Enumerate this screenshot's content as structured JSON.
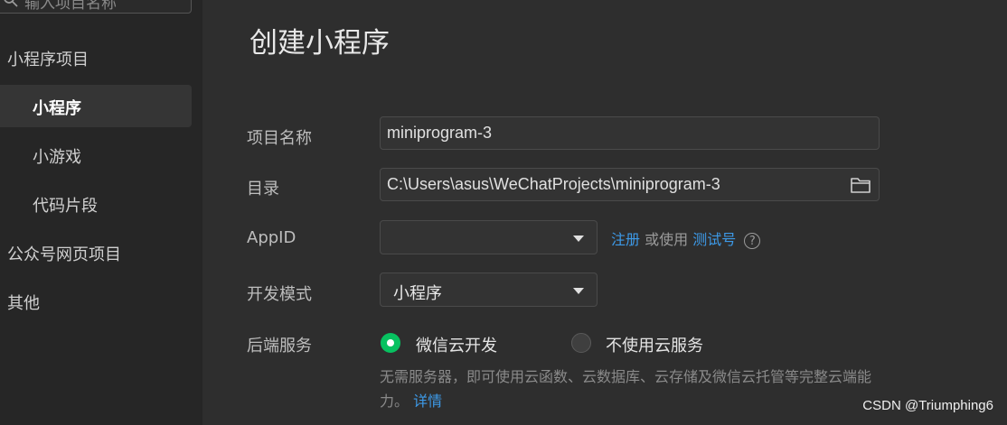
{
  "sidebar": {
    "search_placeholder": "输入项目名称",
    "items": [
      {
        "label": "小程序项目"
      },
      {
        "label": "小程序"
      },
      {
        "label": "小游戏"
      },
      {
        "label": "代码片段"
      },
      {
        "label": "公众号网页项目"
      },
      {
        "label": "其他"
      }
    ]
  },
  "main": {
    "title": "创建小程序",
    "project_name": {
      "label": "项目名称",
      "value": "miniprogram-3"
    },
    "directory": {
      "label": "目录",
      "value": "C:\\Users\\asus\\WeChatProjects\\miniprogram-3"
    },
    "appid": {
      "label": "AppID",
      "value": "",
      "register": "注册",
      "or_use": "或使用",
      "test_account": "测试号",
      "help": "?"
    },
    "dev_mode": {
      "label": "开发模式",
      "value": "小程序"
    },
    "backend": {
      "label": "后端服务",
      "options": [
        {
          "label": "微信云开发",
          "selected": true
        },
        {
          "label": "不使用云服务",
          "selected": false
        }
      ],
      "description": "无需服务器，即可使用云函数、云数据库、云存储及微信云托管等完整云端能力。",
      "details": "详情"
    }
  },
  "watermark": "CSDN @Triumphing6",
  "colors": {
    "accent": "#07c160",
    "link": "#3d9ae8",
    "background": "#2e2e2e",
    "sidebar": "#262626"
  }
}
